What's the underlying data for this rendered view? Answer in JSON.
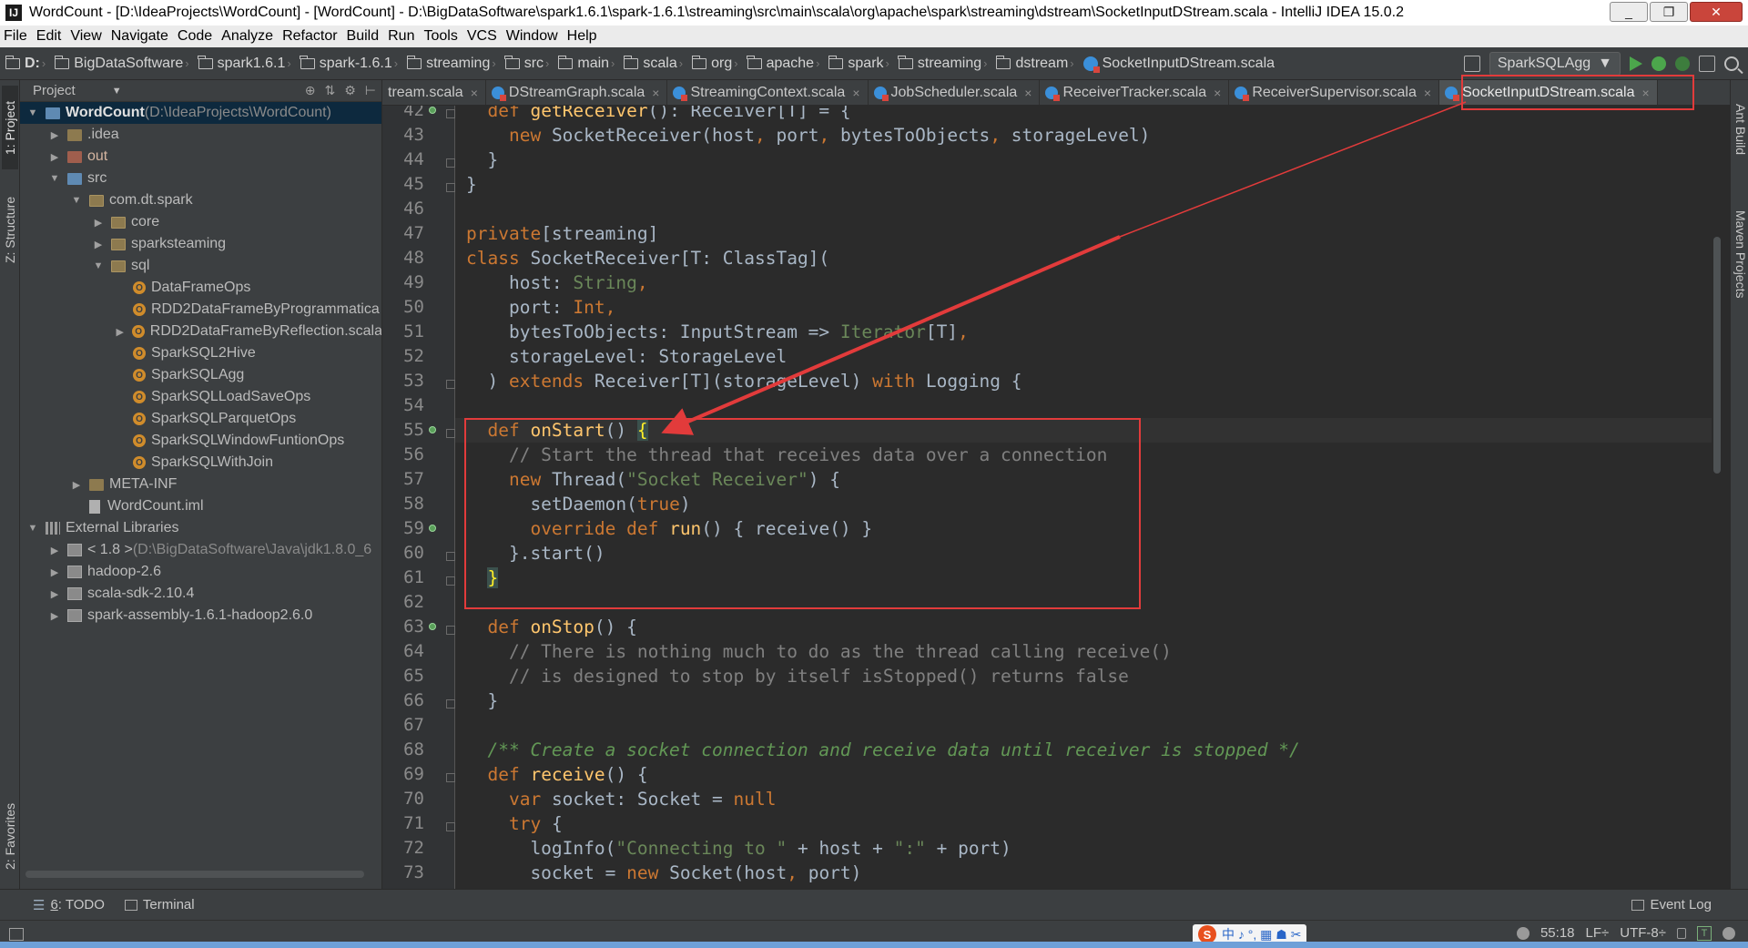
{
  "window": {
    "title": "WordCount - [D:\\IdeaProjects\\WordCount] - [WordCount] - D:\\BigDataSoftware\\spark1.6.1\\spark-1.6.1\\streaming\\src\\main\\scala\\org\\apache\\spark\\streaming\\dstream\\SocketInputDStream.scala - IntelliJ IDEA 15.0.2",
    "minimize": "_",
    "maximize": "❐",
    "close": "✕"
  },
  "menu": [
    "File",
    "Edit",
    "View",
    "Navigate",
    "Code",
    "Analyze",
    "Refactor",
    "Build",
    "Run",
    "Tools",
    "VCS",
    "Window",
    "Help"
  ],
  "breadcrumbs": [
    "D:",
    "BigDataSoftware",
    "spark1.6.1",
    "spark-1.6.1",
    "streaming",
    "src",
    "main",
    "scala",
    "org",
    "apache",
    "spark",
    "streaming",
    "dstream"
  ],
  "breadcrumb_file": "SocketInputDStream.scala",
  "run_config": "SparkSQLAgg",
  "project_panel": {
    "header": "Project",
    "tree": [
      {
        "label": "WordCount",
        "suffix": " (D:\\IdeaProjects\\WordCount)",
        "depth": 0,
        "arrow": "▼",
        "icon": "folder-blue",
        "selected": true
      },
      {
        "label": ".idea",
        "depth": 1,
        "arrow": "▶",
        "icon": "folder"
      },
      {
        "label": "out",
        "depth": 1,
        "arrow": "▶",
        "icon": "folder-red"
      },
      {
        "label": "src",
        "depth": 1,
        "arrow": "▼",
        "icon": "folder-blue"
      },
      {
        "label": "com.dt.spark",
        "depth": 2,
        "arrow": "▼",
        "icon": "package"
      },
      {
        "label": "core",
        "depth": 3,
        "arrow": "▶",
        "icon": "package"
      },
      {
        "label": "sparksteaming",
        "depth": 3,
        "arrow": "▶",
        "icon": "package"
      },
      {
        "label": "sql",
        "depth": 3,
        "arrow": "▼",
        "icon": "package"
      },
      {
        "label": "DataFrameOps",
        "depth": 4,
        "arrow": "",
        "icon": "object"
      },
      {
        "label": "RDD2DataFrameByProgrammatica",
        "depth": 4,
        "arrow": "",
        "icon": "object"
      },
      {
        "label": "RDD2DataFrameByReflection.scala",
        "depth": 4,
        "arrow": "▶",
        "icon": "object"
      },
      {
        "label": "SparkSQL2Hive",
        "depth": 4,
        "arrow": "",
        "icon": "object"
      },
      {
        "label": "SparkSQLAgg",
        "depth": 4,
        "arrow": "",
        "icon": "object"
      },
      {
        "label": "SparkSQLLoadSaveOps",
        "depth": 4,
        "arrow": "",
        "icon": "object"
      },
      {
        "label": "SparkSQLParquetOps",
        "depth": 4,
        "arrow": "",
        "icon": "object"
      },
      {
        "label": "SparkSQLWindowFuntionOps",
        "depth": 4,
        "arrow": "",
        "icon": "object"
      },
      {
        "label": "SparkSQLWithJoin",
        "depth": 4,
        "arrow": "",
        "icon": "object"
      },
      {
        "label": "META-INF",
        "depth": 2,
        "arrow": "▶",
        "icon": "folder"
      },
      {
        "label": "WordCount.iml",
        "depth": 2,
        "arrow": "",
        "icon": "file"
      },
      {
        "label": "External Libraries",
        "depth": 0,
        "arrow": "▼",
        "icon": "library"
      },
      {
        "label": "< 1.8 >",
        "suffix": " (D:\\BigDataSoftware\\Java\\jdk1.8.0_6",
        "depth": 1,
        "arrow": "▶",
        "icon": "jar"
      },
      {
        "label": "hadoop-2.6",
        "depth": 1,
        "arrow": "▶",
        "icon": "jar"
      },
      {
        "label": "scala-sdk-2.10.4",
        "depth": 1,
        "arrow": "▶",
        "icon": "jar"
      },
      {
        "label": "spark-assembly-1.6.1-hadoop2.6.0",
        "depth": 1,
        "arrow": "▶",
        "icon": "jar"
      }
    ]
  },
  "tabs": [
    {
      "label": "tream.scala",
      "active": false
    },
    {
      "label": "DStreamGraph.scala",
      "active": false
    },
    {
      "label": "StreamingContext.scala",
      "active": false
    },
    {
      "label": "JobScheduler.scala",
      "active": false
    },
    {
      "label": "ReceiverTracker.scala",
      "active": false
    },
    {
      "label": "ReceiverSupervisor.scala",
      "active": false
    },
    {
      "label": "SocketInputDStream.scala",
      "active": true
    }
  ],
  "code": [
    {
      "n": "42",
      "t": [
        [
          "  ",
          ""
        ],
        [
          "def ",
          "kw"
        ],
        [
          "getReceiver",
          "fn"
        ],
        [
          "(): Receiver[T] = {",
          "id"
        ]
      ],
      "mark": true,
      "fold": true
    },
    {
      "n": "43",
      "t": [
        [
          "    ",
          ""
        ],
        [
          "new ",
          "kw"
        ],
        [
          "SocketReceiver(host",
          "id"
        ],
        [
          ", ",
          "kw"
        ],
        [
          "port",
          "id"
        ],
        [
          ", ",
          "kw"
        ],
        [
          "bytesToObjects",
          "id"
        ],
        [
          ", ",
          "kw"
        ],
        [
          "storageLevel)",
          "id"
        ]
      ]
    },
    {
      "n": "44",
      "t": [
        [
          "  }",
          "id"
        ]
      ],
      "fold": true
    },
    {
      "n": "45",
      "t": [
        [
          "}",
          "id"
        ]
      ],
      "fold": true
    },
    {
      "n": "46",
      "t": []
    },
    {
      "n": "47",
      "t": [
        [
          "private",
          "kw"
        ],
        [
          "[streaming]",
          "id"
        ]
      ]
    },
    {
      "n": "48",
      "t": [
        [
          "class ",
          "kw"
        ],
        [
          "SocketReceiver[T: ClassTag](",
          "id"
        ]
      ]
    },
    {
      "n": "49",
      "t": [
        [
          "    host: ",
          "id"
        ],
        [
          "String",
          "str"
        ],
        [
          ",",
          "kw"
        ]
      ]
    },
    {
      "n": "50",
      "t": [
        [
          "    port: ",
          "id"
        ],
        [
          "Int",
          "kw"
        ],
        [
          ",",
          "kw"
        ]
      ]
    },
    {
      "n": "51",
      "t": [
        [
          "    bytesToObjects: InputStream => ",
          "id"
        ],
        [
          "Iterator",
          "str"
        ],
        [
          "[T]",
          "id"
        ],
        [
          ",",
          "kw"
        ]
      ]
    },
    {
      "n": "52",
      "t": [
        [
          "    storageLevel: StorageLevel",
          "id"
        ]
      ]
    },
    {
      "n": "53",
      "t": [
        [
          "  ) ",
          "id"
        ],
        [
          "extends ",
          "kw"
        ],
        [
          "Receiver[T](storageLevel) ",
          "id"
        ],
        [
          "with ",
          "kw"
        ],
        [
          "Logging {",
          "id"
        ]
      ],
      "fold": true
    },
    {
      "n": "54",
      "t": []
    },
    {
      "n": "55",
      "t": [
        [
          "  ",
          ""
        ],
        [
          "def ",
          "kw"
        ],
        [
          "onStart",
          "fn"
        ],
        [
          "() ",
          "id"
        ],
        [
          "{",
          "brace"
        ]
      ],
      "mark": true,
      "fold": true,
      "caret": true
    },
    {
      "n": "56",
      "t": [
        [
          "    // Start the thread that receives data over a connection",
          "cm"
        ]
      ]
    },
    {
      "n": "57",
      "t": [
        [
          "    ",
          ""
        ],
        [
          "new ",
          "kw"
        ],
        [
          "Thread(",
          "id"
        ],
        [
          "\"Socket Receiver\"",
          "str"
        ],
        [
          ") {",
          "id"
        ]
      ]
    },
    {
      "n": "58",
      "t": [
        [
          "      setDaemon(",
          "id"
        ],
        [
          "true",
          "kw"
        ],
        [
          ")",
          "id"
        ]
      ]
    },
    {
      "n": "59",
      "t": [
        [
          "      ",
          ""
        ],
        [
          "override def ",
          "kw"
        ],
        [
          "run",
          "fn"
        ],
        [
          "() { receive() }",
          "id"
        ]
      ],
      "mark": true
    },
    {
      "n": "60",
      "t": [
        [
          "    }.start()",
          "id"
        ]
      ],
      "fold": true
    },
    {
      "n": "61",
      "t": [
        [
          "  ",
          ""
        ],
        [
          "}",
          "brace"
        ]
      ],
      "fold": true
    },
    {
      "n": "62",
      "t": []
    },
    {
      "n": "63",
      "t": [
        [
          "  ",
          ""
        ],
        [
          "def ",
          "kw"
        ],
        [
          "onStop",
          "fn"
        ],
        [
          "() {",
          "id"
        ]
      ],
      "mark": true,
      "fold": true
    },
    {
      "n": "64",
      "t": [
        [
          "    // There is nothing much to do as the thread calling receive()",
          "cm"
        ]
      ]
    },
    {
      "n": "65",
      "t": [
        [
          "    // is designed to stop by itself isStopped() returns false",
          "cm"
        ]
      ]
    },
    {
      "n": "66",
      "t": [
        [
          "  }",
          "id"
        ]
      ],
      "fold": true
    },
    {
      "n": "67",
      "t": []
    },
    {
      "n": "68",
      "t": [
        [
          "  /** Create a socket connection and receive data until receiver is stopped */",
          "dc"
        ]
      ]
    },
    {
      "n": "69",
      "t": [
        [
          "  ",
          ""
        ],
        [
          "def ",
          "kw"
        ],
        [
          "receive",
          "fn"
        ],
        [
          "() {",
          "id"
        ]
      ],
      "fold": true
    },
    {
      "n": "70",
      "t": [
        [
          "    ",
          ""
        ],
        [
          "var ",
          "kw"
        ],
        [
          "socket: Socket = ",
          "id"
        ],
        [
          "null",
          "kw"
        ]
      ]
    },
    {
      "n": "71",
      "t": [
        [
          "    ",
          ""
        ],
        [
          "try ",
          "kw"
        ],
        [
          "{",
          "id"
        ]
      ],
      "fold": true
    },
    {
      "n": "72",
      "t": [
        [
          "      logInfo(",
          "id"
        ],
        [
          "\"Connecting to \"",
          "str"
        ],
        [
          " + host + ",
          "id"
        ],
        [
          "\":\"",
          "str"
        ],
        [
          " + port)",
          "id"
        ]
      ]
    },
    {
      "n": "73",
      "t": [
        [
          "      socket = ",
          "id"
        ],
        [
          "new ",
          "kw"
        ],
        [
          "Socket(host",
          "id"
        ],
        [
          ", ",
          "kw"
        ],
        [
          "port)",
          "id"
        ]
      ]
    }
  ],
  "side_tabs": {
    "project": "1: Project",
    "structure": "Z: Structure",
    "favorites": "2: Favorites",
    "ant": "Ant Build",
    "maven": "Maven Projects"
  },
  "bottom": {
    "todo_num": "6",
    "todo_label": ": TODO",
    "terminal": "Terminal",
    "event_log": "Event Log"
  },
  "ime_text": "中 ♪ °, ▦ ☗ ✂",
  "status": {
    "position": "55:18",
    "line_sep": "LF÷",
    "encoding": "UTF-8÷"
  },
  "colors": {
    "annotation": "#e23b3b",
    "keyword": "#cc7832",
    "function": "#ffc66d",
    "string": "#6a8759",
    "comment": "#808080"
  }
}
